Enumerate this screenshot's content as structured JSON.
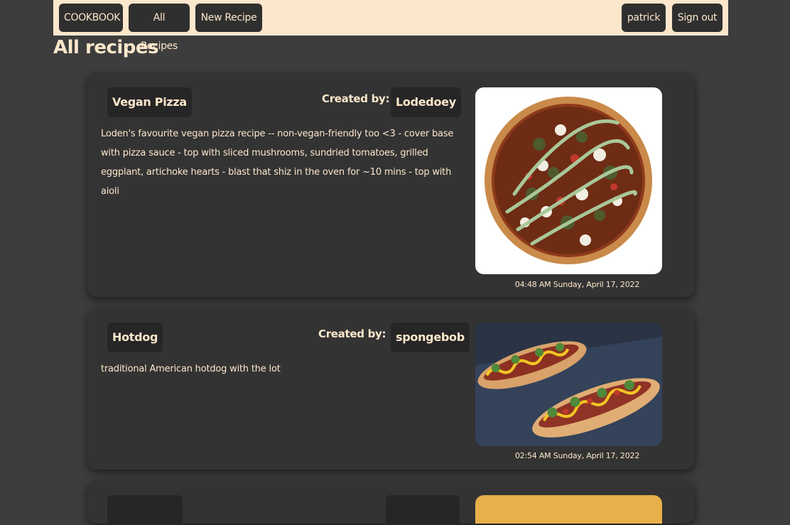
{
  "nav": {
    "brand": "COOKBOOK",
    "all_recipes": "All Recipes",
    "new_recipe": "New Recipe",
    "user": "patrick",
    "sign_out": "Sign out"
  },
  "page": {
    "title": "All recipes"
  },
  "recipes": [
    {
      "title": "Vegan Pizza",
      "created_by_label": "Created by:",
      "author": "Lodedoey",
      "description": "Loden's favourite vegan pizza recipe -- non-vegan-friendly too <3 - cover base with pizza sauce - top with sliced mushrooms, sundried tomatoes, grilled eggplant, artichoke hearts - blast that shiz in the oven for ~10 mins - top with aioli",
      "timestamp": "04:48 AM Sunday, April 17, 2022",
      "image": "vegan-pizza-photo"
    },
    {
      "title": "Hotdog",
      "created_by_label": "Created by:",
      "author": "spongebob",
      "description": "traditional American hotdog with the lot",
      "timestamp": "02:54 AM Sunday, April 17, 2022",
      "image": "hotdog-photo"
    }
  ],
  "colors": {
    "background": "#3d3d3d",
    "card": "#333333",
    "navbar": "#fde7cc",
    "accent_text": "#fde7cc"
  }
}
